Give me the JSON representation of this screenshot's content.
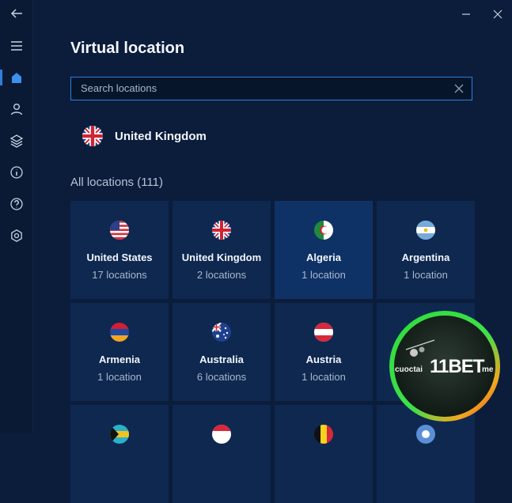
{
  "header": {
    "title": "Virtual location"
  },
  "search": {
    "placeholder": "Search locations",
    "value": ""
  },
  "recent": {
    "label": "United Kingdom",
    "flag": "uk"
  },
  "section": {
    "label": "All locations (111)"
  },
  "locations": [
    {
      "name": "United States",
      "count": "17 locations",
      "flag": "us"
    },
    {
      "name": "United Kingdom",
      "count": "2 locations",
      "flag": "uk"
    },
    {
      "name": "Algeria",
      "count": "1 location",
      "flag": "dz",
      "selected": true
    },
    {
      "name": "Argentina",
      "count": "1 location",
      "flag": "ar"
    },
    {
      "name": "Armenia",
      "count": "1 location",
      "flag": "am"
    },
    {
      "name": "Australia",
      "count": "6 locations",
      "flag": "au"
    },
    {
      "name": "Austria",
      "count": "1 location",
      "flag": "at"
    }
  ],
  "badge": {
    "prefix": "cuoctai",
    "brand": "11BET",
    "suffix": "me"
  },
  "colors": {
    "accent": "#2f7fdc",
    "background": "#0b1d3b",
    "card": "#0e2850",
    "card_selected": "#0f3266"
  }
}
